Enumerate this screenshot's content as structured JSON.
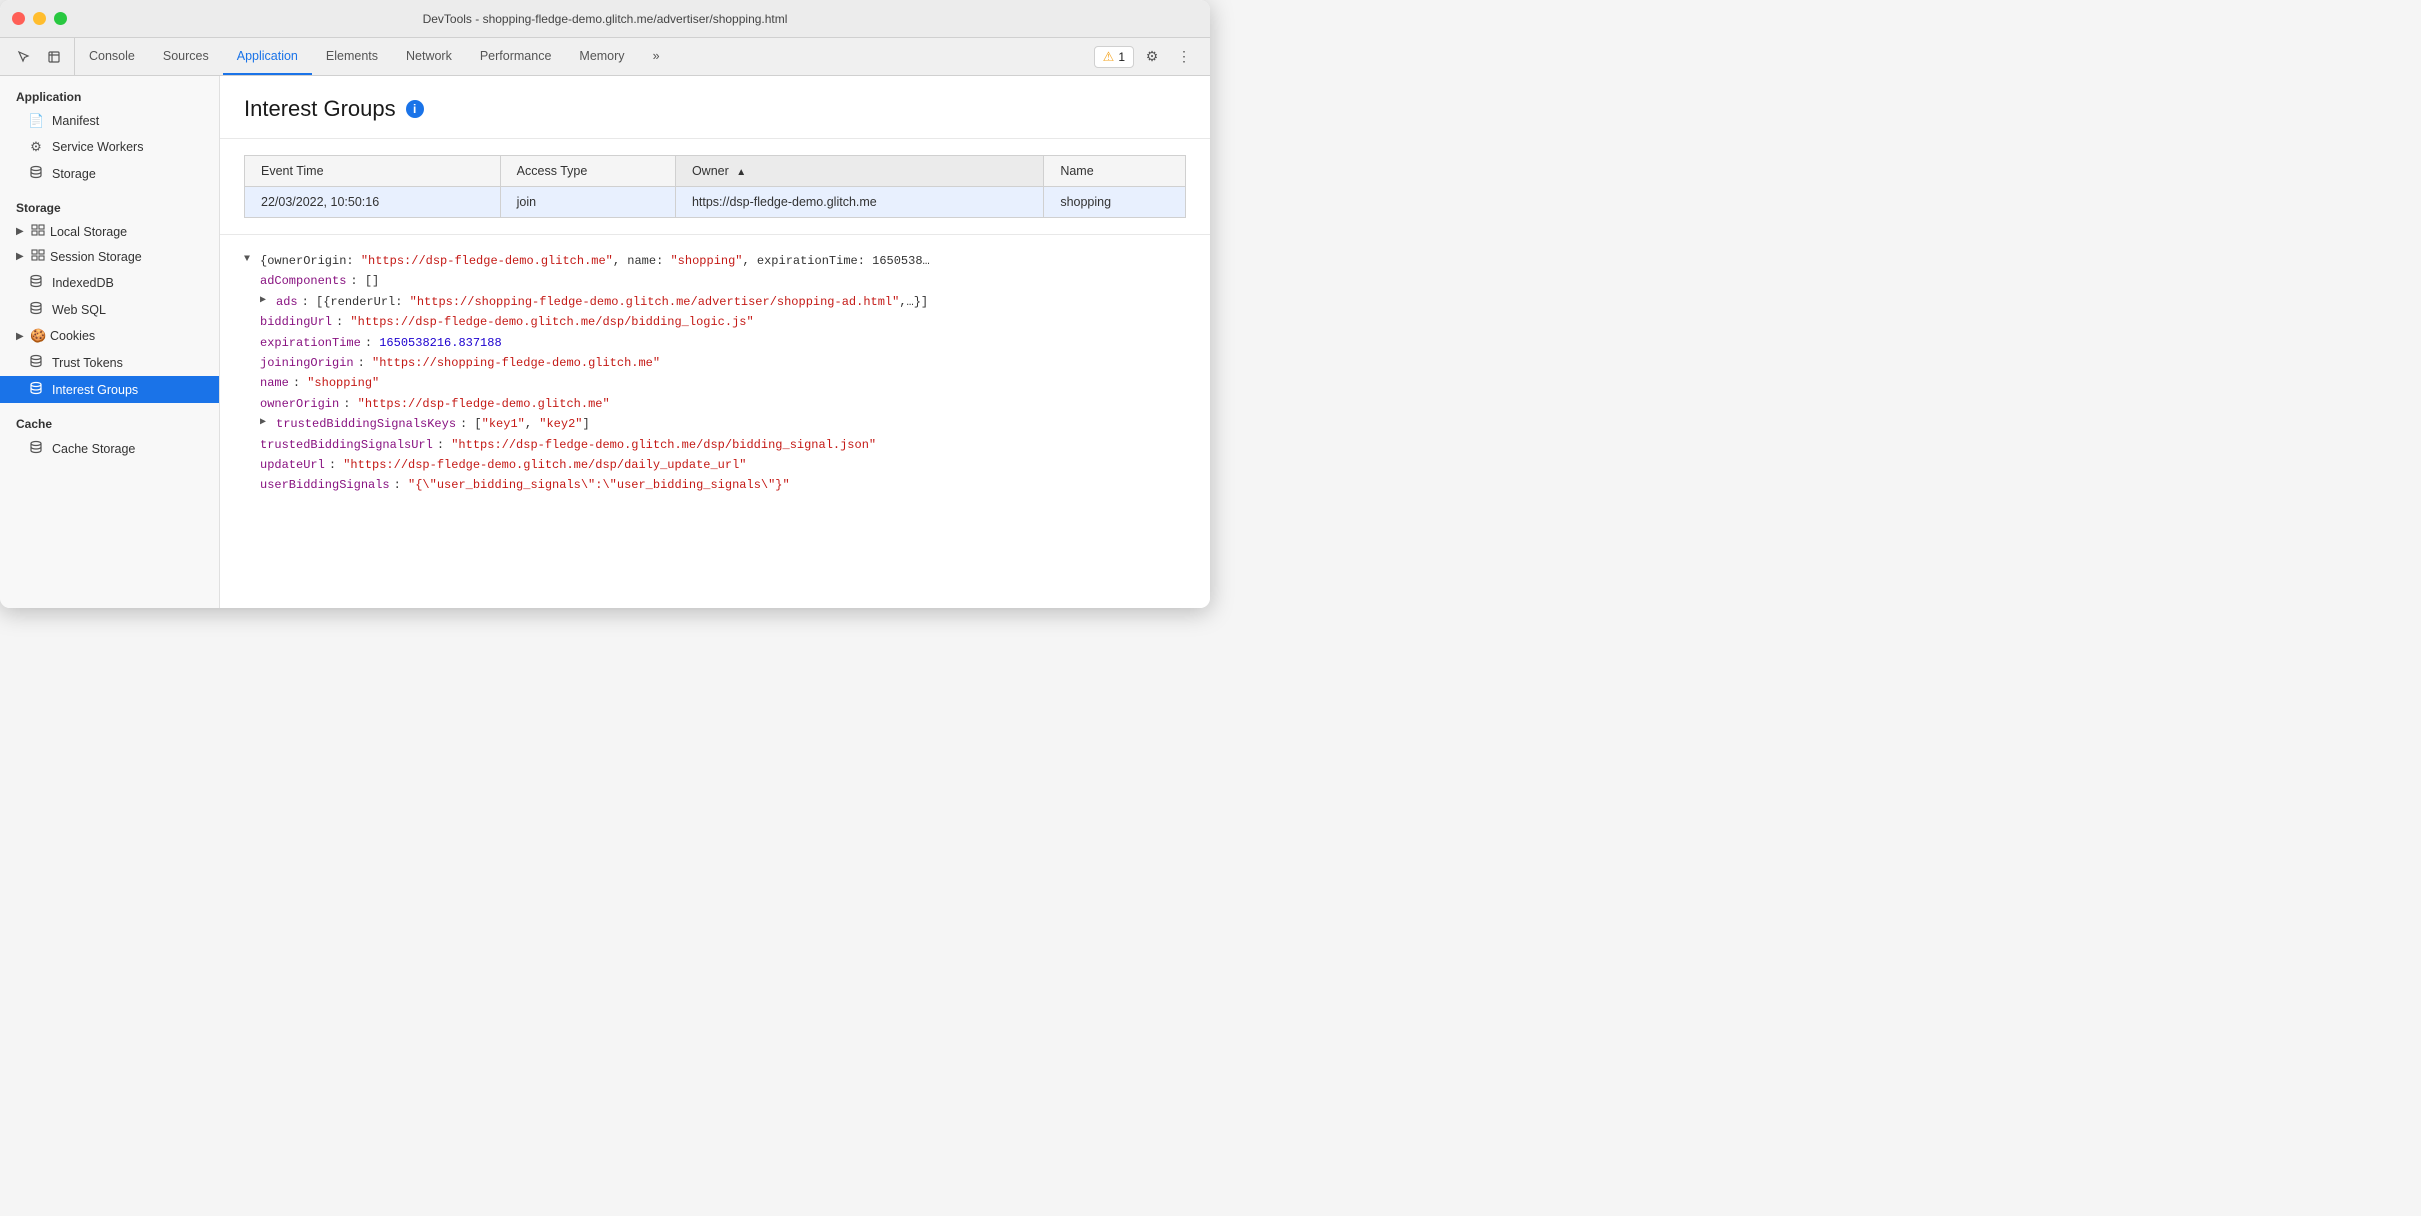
{
  "titlebar": {
    "title": "DevTools - shopping-fledge-demo.glitch.me/advertiser/shopping.html"
  },
  "toolbar": {
    "tabs": [
      {
        "id": "console",
        "label": "Console",
        "active": false
      },
      {
        "id": "sources",
        "label": "Sources",
        "active": false
      },
      {
        "id": "application",
        "label": "Application",
        "active": true
      },
      {
        "id": "elements",
        "label": "Elements",
        "active": false
      },
      {
        "id": "network",
        "label": "Network",
        "active": false
      },
      {
        "id": "performance",
        "label": "Performance",
        "active": false
      },
      {
        "id": "memory",
        "label": "Memory",
        "active": false
      }
    ],
    "more_label": "»",
    "warning_count": "1",
    "warning_icon": "⚠"
  },
  "sidebar": {
    "application_section": "Application",
    "items_application": [
      {
        "id": "manifest",
        "label": "Manifest",
        "icon": "📄"
      },
      {
        "id": "service-workers",
        "label": "Service Workers",
        "icon": "⚙"
      },
      {
        "id": "storage",
        "label": "Storage",
        "icon": "🗄"
      }
    ],
    "storage_section": "Storage",
    "items_storage": [
      {
        "id": "local-storage",
        "label": "Local Storage",
        "icon": "▦",
        "has_arrow": true
      },
      {
        "id": "session-storage",
        "label": "Session Storage",
        "icon": "▦",
        "has_arrow": true
      },
      {
        "id": "indexeddb",
        "label": "IndexedDB",
        "icon": "🗄",
        "has_arrow": false
      },
      {
        "id": "web-sql",
        "label": "Web SQL",
        "icon": "🗄",
        "has_arrow": false
      },
      {
        "id": "cookies",
        "label": "Cookies",
        "icon": "🍪",
        "has_arrow": true
      },
      {
        "id": "trust-tokens",
        "label": "Trust Tokens",
        "icon": "🗄",
        "has_arrow": false
      },
      {
        "id": "interest-groups",
        "label": "Interest Groups",
        "icon": "🗄",
        "active": true
      }
    ],
    "cache_section": "Cache",
    "items_cache": [
      {
        "id": "cache-storage",
        "label": "Cache Storage",
        "icon": "🗄",
        "has_arrow": false
      }
    ]
  },
  "content": {
    "title": "Interest Groups",
    "table": {
      "columns": [
        {
          "id": "event-time",
          "label": "Event Time",
          "sorted": false
        },
        {
          "id": "access-type",
          "label": "Access Type",
          "sorted": false
        },
        {
          "id": "owner",
          "label": "Owner",
          "sorted": true,
          "sort_dir": "asc"
        },
        {
          "id": "name",
          "label": "Name",
          "sorted": false
        }
      ],
      "rows": [
        {
          "event_time": "22/03/2022, 10:50:16",
          "access_type": "join",
          "owner": "https://dsp-fledge-demo.glitch.me",
          "name": "shopping",
          "selected": true
        }
      ]
    },
    "json_detail": {
      "line1_plain": "▼ {ownerOrigin: \"https://dsp-fledge-demo.glitch.me\", name: \"shopping\", expirationTime: 1650538…",
      "lines": [
        {
          "indent": 1,
          "type": "plain",
          "text": "adComponents: []"
        },
        {
          "indent": 1,
          "type": "expandable",
          "arrow": "▶",
          "key": "ads",
          "value": "[{renderUrl: \"https://shopping-fledge-demo.glitch.me/advertiser/shopping-ad.html\",…}]"
        },
        {
          "indent": 1,
          "type": "key-string",
          "key": "biddingUrl",
          "value": "\"https://dsp-fledge-demo.glitch.me/dsp/bidding_logic.js\""
        },
        {
          "indent": 1,
          "type": "key-number",
          "key": "expirationTime",
          "value": "1650538216.837188"
        },
        {
          "indent": 1,
          "type": "key-string",
          "key": "joiningOrigin",
          "value": "\"https://shopping-fledge-demo.glitch.me\""
        },
        {
          "indent": 1,
          "type": "key-string",
          "key": "name",
          "value": "\"shopping\""
        },
        {
          "indent": 1,
          "type": "key-string",
          "key": "ownerOrigin",
          "value": "\"https://dsp-fledge-demo.glitch.me\""
        },
        {
          "indent": 1,
          "type": "expandable",
          "arrow": "▶",
          "key": "trustedBiddingSignalsKeys",
          "value": "[\"key1\", \"key2\"]"
        },
        {
          "indent": 1,
          "type": "key-string",
          "key": "trustedBiddingSignalsUrl",
          "value": "\"https://dsp-fledge-demo.glitch.me/dsp/bidding_signal.json\""
        },
        {
          "indent": 1,
          "type": "key-string",
          "key": "updateUrl",
          "value": "\"https://dsp-fledge-demo.glitch.me/dsp/daily_update_url\""
        },
        {
          "indent": 1,
          "type": "key-string",
          "key": "userBiddingSignals",
          "value": "\"{\\\"user_bidding_signals\\\":\\\"user_bidding_signals\\\"}\""
        }
      ]
    }
  }
}
